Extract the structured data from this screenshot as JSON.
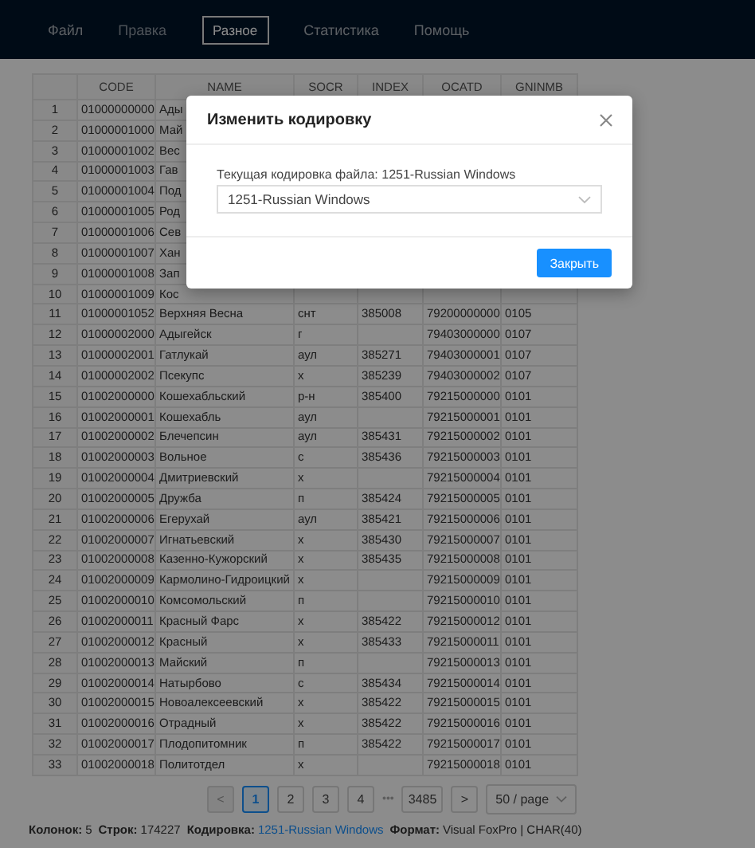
{
  "menu": [
    {
      "label": "Файл",
      "disabled": false,
      "selected": false
    },
    {
      "label": "Правка",
      "disabled": true,
      "selected": false
    },
    {
      "label": "Разное",
      "disabled": false,
      "selected": true
    },
    {
      "label": "Статистика",
      "disabled": false,
      "selected": false
    },
    {
      "label": "Помощь",
      "disabled": false,
      "selected": false
    }
  ],
  "table": {
    "columns": [
      "",
      "CODE",
      "NAME",
      "SOCR",
      "INDEX",
      "OCATD",
      "GNINMB"
    ],
    "rows": [
      {
        "cells": [
          "1",
          "01000000000",
          "Ады"
        ]
      },
      {
        "cells": [
          "2",
          "01000001000",
          "Май"
        ]
      },
      {
        "cells": [
          "3",
          "01000001002",
          "Вес"
        ]
      },
      {
        "cells": [
          "4",
          "01000001003",
          "Гав"
        ]
      },
      {
        "cells": [
          "5",
          "01000001004",
          "Под"
        ]
      },
      {
        "cells": [
          "6",
          "01000001005",
          "Род"
        ]
      },
      {
        "cells": [
          "7",
          "01000001006",
          "Сев"
        ]
      },
      {
        "cells": [
          "8",
          "01000001007",
          "Хан"
        ]
      },
      {
        "cells": [
          "9",
          "01000001008",
          "Зап"
        ]
      },
      {
        "cells": [
          "10",
          "01000001009",
          "Кос"
        ]
      },
      {
        "cells": [
          "11",
          "01000001052",
          "Верхняя Весна",
          "снт",
          "385008",
          "79200000000",
          "0105"
        ]
      },
      {
        "cells": [
          "12",
          "01000002000",
          "Адыгейск",
          "г",
          null,
          "79403000000",
          "0107"
        ]
      },
      {
        "cells": [
          "13",
          "01000002001",
          "Гатлукай",
          "аул",
          "385271",
          "79403000001",
          "0107"
        ]
      },
      {
        "cells": [
          "14",
          "01000002002",
          "Псекупс",
          "х",
          "385239",
          "79403000002",
          "0107"
        ]
      },
      {
        "cells": [
          "15",
          "01002000000",
          "Кошехабльский",
          "р-н",
          "385400",
          "79215000000",
          "0101"
        ]
      },
      {
        "cells": [
          "16",
          "01002000001",
          "Кошехабль",
          "аул",
          null,
          "79215000001",
          "0101"
        ]
      },
      {
        "cells": [
          "17",
          "01002000002",
          "Блечепсин",
          "аул",
          "385431",
          "79215000002",
          "0101"
        ]
      },
      {
        "cells": [
          "18",
          "01002000003",
          "Вольное",
          "с",
          "385436",
          "79215000003",
          "0101"
        ]
      },
      {
        "cells": [
          "19",
          "01002000004",
          "Дмитриевский",
          "х",
          null,
          "79215000004",
          "0101"
        ]
      },
      {
        "cells": [
          "20",
          "01002000005",
          "Дружба",
          "п",
          "385424",
          "79215000005",
          "0101"
        ]
      },
      {
        "cells": [
          "21",
          "01002000006",
          "Егерухай",
          "аул",
          "385421",
          "79215000006",
          "0101"
        ]
      },
      {
        "cells": [
          "22",
          "01002000007",
          "Игнатьевский",
          "х",
          "385430",
          "79215000007",
          "0101"
        ]
      },
      {
        "cells": [
          "23",
          "01002000008",
          "Казенно-Кужорский",
          "х",
          "385435",
          "79215000008",
          "0101"
        ]
      },
      {
        "cells": [
          "24",
          "01002000009",
          "Кармолино-Гидроицкий",
          "х",
          null,
          "79215000009",
          "0101"
        ]
      },
      {
        "cells": [
          "25",
          "01002000010",
          "Комсомольский",
          "п",
          null,
          "79215000010",
          "0101"
        ]
      },
      {
        "cells": [
          "26",
          "01002000011",
          "Красный Фарс",
          "х",
          "385422",
          "79215000012",
          "0101"
        ]
      },
      {
        "cells": [
          "27",
          "01002000012",
          "Красный",
          "х",
          "385433",
          "79215000011",
          "0101"
        ]
      },
      {
        "cells": [
          "28",
          "01002000013",
          "Майский",
          "п",
          null,
          "79215000013",
          "0101"
        ]
      },
      {
        "cells": [
          "29",
          "01002000014",
          "Натырбово",
          "с",
          "385434",
          "79215000014",
          "0101"
        ]
      },
      {
        "cells": [
          "30",
          "01002000015",
          "Новоалексеевский",
          "х",
          "385422",
          "79215000015",
          "0101"
        ]
      },
      {
        "cells": [
          "31",
          "01002000016",
          "Отрадный",
          "х",
          "385422",
          "79215000016",
          "0101"
        ]
      },
      {
        "cells": [
          "32",
          "01002000017",
          "Плодопитомник",
          "п",
          "385422",
          "79215000017",
          "0101"
        ]
      },
      {
        "cells": [
          "33",
          "01002000018",
          "Политотдел",
          "х",
          null,
          "79215000018",
          "0101"
        ]
      }
    ]
  },
  "pagination": {
    "prev": {
      "label": "<",
      "disabled": true
    },
    "pages": [
      {
        "label": "1",
        "kind": "page",
        "selected": true
      },
      {
        "label": "2",
        "kind": "page",
        "selected": false
      },
      {
        "label": "3",
        "kind": "page",
        "selected": false
      },
      {
        "label": "4",
        "kind": "page",
        "selected": false
      },
      {
        "label": "•••",
        "kind": "ellipsis"
      },
      {
        "label": "3485",
        "kind": "page",
        "selected": false
      }
    ],
    "next": {
      "label": ">",
      "disabled": false
    },
    "page_size": "50 / page"
  },
  "status_bar": {
    "items": [
      {
        "label": "Колонок:",
        "value": "5",
        "kind": "plain"
      },
      {
        "label": "Строк:",
        "value": "174227",
        "kind": "plain"
      },
      {
        "label": "Кодировка:",
        "value": "1251-Russian Windows",
        "kind": "link"
      },
      {
        "label": "Формат:",
        "value": "Visual FoxPro | CHAR(40)",
        "kind": "plain"
      }
    ]
  },
  "modal": {
    "title": "Изменить кодировку",
    "label": "Текущая кодировка файла: 1251-Russian Windows",
    "select_value": "1251-Russian Windows",
    "button": "Закрыть"
  }
}
